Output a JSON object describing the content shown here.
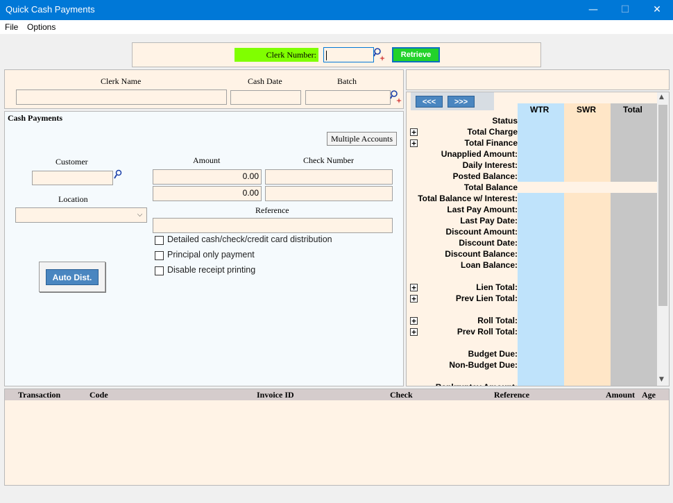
{
  "window": {
    "title": "Quick Cash Payments",
    "minimize": "—",
    "maximize": "☐",
    "close": "✕"
  },
  "menu": {
    "file": "File",
    "options": "Options"
  },
  "clerk": {
    "label": "Clerk Number:",
    "value": "",
    "retrieve": "Retrieve"
  },
  "header": {
    "clerk_name_label": "Clerk Name",
    "cash_date_label": "Cash Date",
    "batch_label": "Batch",
    "clerk_name": "",
    "cash_date": "",
    "batch": ""
  },
  "cash_payments": {
    "title": "Cash Payments",
    "multiple_accounts": "Multiple Accounts",
    "customer_label": "Customer",
    "location_label": "Location",
    "amount_label": "Amount",
    "check_number_label": "Check Number",
    "amount1": "0.00",
    "amount2": "0.00",
    "reference_label": "Reference",
    "checkboxes": [
      "Detailed cash/check/credit card distribution",
      "Principal only payment",
      "Disable receipt printing"
    ],
    "auto_dist": "Auto Dist."
  },
  "balances": {
    "prev_btn": "<<<",
    "next_btn": ">>>",
    "columns": [
      "WTR",
      "SWR",
      "Total"
    ],
    "rows": [
      {
        "label": "Status",
        "plus": false
      },
      {
        "label": "Total Charge",
        "plus": true
      },
      {
        "label": "Total Finance",
        "plus": true
      },
      {
        "label": "Unapplied Amount:",
        "plus": false
      },
      {
        "label": "Daily Interest:",
        "plus": false
      },
      {
        "label": "Posted Balance:",
        "plus": false
      },
      {
        "label": "Total Balance",
        "plus": false
      },
      {
        "label": "Total Balance w/ Interest:",
        "plus": false
      },
      {
        "label": "Last Pay Amount:",
        "plus": false
      },
      {
        "label": "Last Pay Date:",
        "plus": false
      },
      {
        "label": "Discount Amount:",
        "plus": false
      },
      {
        "label": "Discount Date:",
        "plus": false
      },
      {
        "label": "Discount Balance:",
        "plus": false
      },
      {
        "label": "Loan Balance:",
        "plus": false
      },
      {
        "label": "",
        "plus": false
      },
      {
        "label": "Lien Total:",
        "plus": true
      },
      {
        "label": "Prev Lien Total:",
        "plus": true
      },
      {
        "label": "",
        "plus": false
      },
      {
        "label": "Roll Total:",
        "plus": true
      },
      {
        "label": "Prev Roll Total:",
        "plus": true
      },
      {
        "label": "",
        "plus": false
      },
      {
        "label": "Budget Due:",
        "plus": false
      },
      {
        "label": "Non-Budget Due:",
        "plus": false
      },
      {
        "label": "",
        "plus": false
      },
      {
        "label": "Bankruptcy Amount:",
        "plus": false
      }
    ],
    "colors": {
      "wtr": "#bfe3fb",
      "swr": "#ffe6c7",
      "total": "#c6c6c6"
    }
  },
  "transactions": {
    "columns": [
      "Transaction",
      "Code",
      "Invoice ID",
      "Check",
      "Reference",
      "Amount",
      "Age"
    ]
  }
}
